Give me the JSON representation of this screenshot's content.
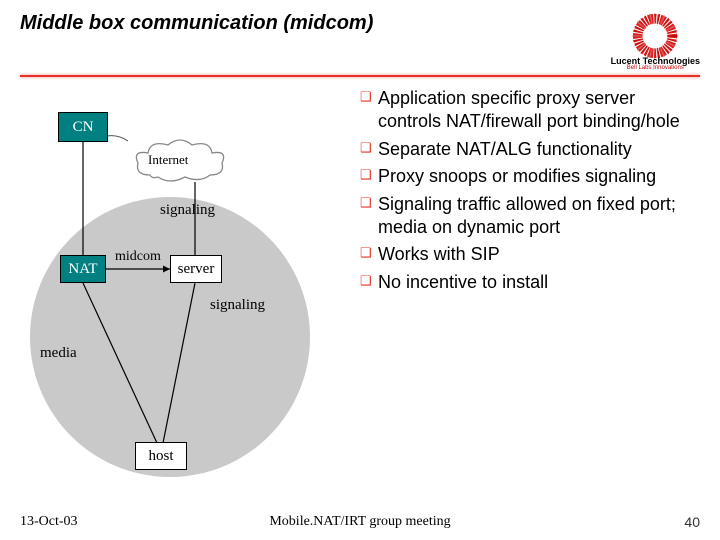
{
  "title": "Middle box communication (midcom)",
  "logo": {
    "company": "Lucent Technologies",
    "tagline": "Bell Labs Innovations"
  },
  "diagram": {
    "nodes": {
      "cn": "CN",
      "nat": "NAT",
      "server": "server",
      "host": "host"
    },
    "cloud_label": "Internet",
    "labels": {
      "signaling1": "signaling",
      "signaling2": "signaling",
      "midcom": "midcom",
      "media": "media"
    }
  },
  "bullets": [
    "Application specific proxy server controls NAT/firewall port binding/hole",
    "Separate NAT/ALG functionality",
    "Proxy snoops or modifies signaling",
    "Signaling traffic allowed on fixed port; media on dynamic port",
    "Works with SIP",
    "No incentive to install"
  ],
  "footer": {
    "date": "13-Oct-03",
    "meeting": "Mobile.NAT/IRT group meeting",
    "page": "40"
  }
}
